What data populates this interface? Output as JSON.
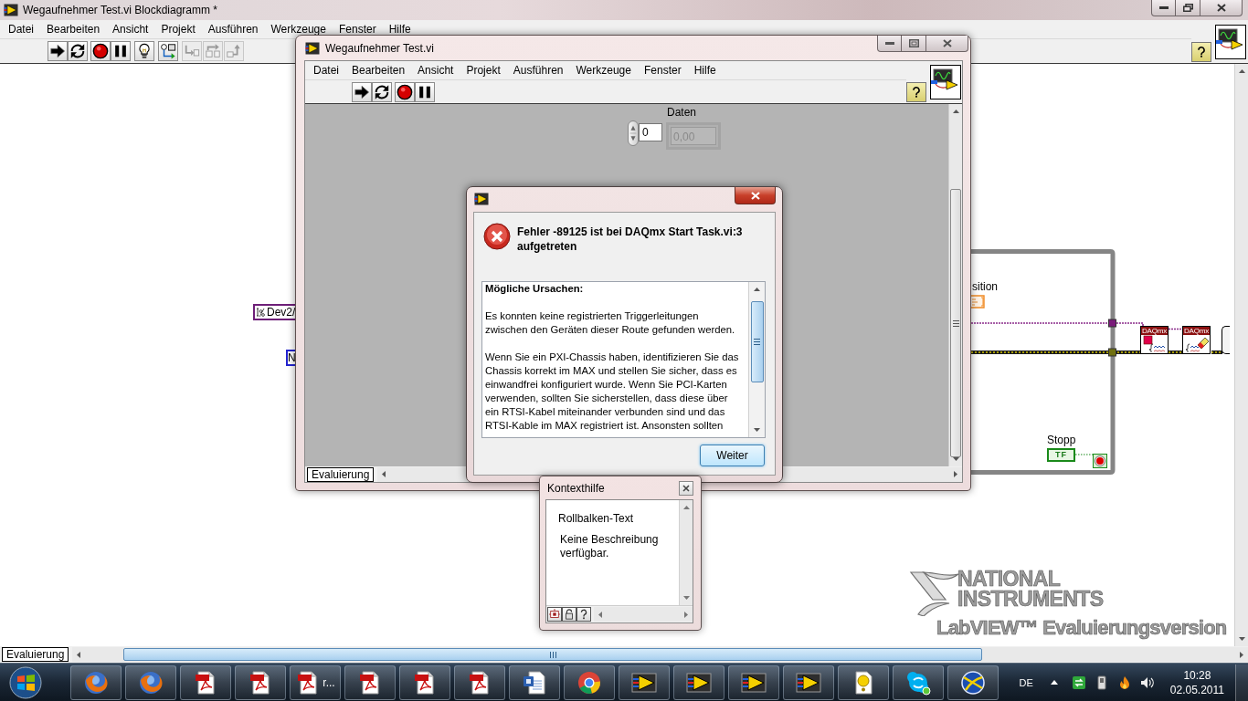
{
  "block_diagram_window": {
    "title": "Wegaufnehmer Test.vi Blockdiagramm *",
    "menu": [
      "Datei",
      "Bearbeiten",
      "Ansicht",
      "Projekt",
      "Ausführen",
      "Werkzeuge",
      "Fenster",
      "Hilfe"
    ],
    "toolbar": [
      {
        "kind": "run",
        "disabled": false
      },
      {
        "kind": "run_continuously",
        "disabled": false
      },
      {
        "kind": "abort",
        "disabled": false
      },
      {
        "kind": "pause",
        "disabled": false
      },
      {
        "kind": "highlight",
        "disabled": false
      },
      {
        "kind": "retain",
        "disabled": false
      },
      {
        "kind": "step_into",
        "disabled": true
      },
      {
        "kind": "step_over",
        "disabled": true
      },
      {
        "kind": "step_out",
        "disabled": true
      }
    ],
    "diagram": {
      "constants": [
        {
          "kind": "io_name",
          "text": "Dev2/"
        },
        {
          "kind": "numeric",
          "text": "N"
        }
      ],
      "terminal_label": "sition",
      "nodes": [
        {
          "kind": "start",
          "title": "DAQmx"
        },
        {
          "kind": "clear",
          "title": "DAQmx"
        }
      ],
      "stop_control": {
        "label": "Stopp",
        "text": "TF"
      }
    },
    "bottom_tab": "Evaluierung"
  },
  "front_panel_window": {
    "title": "Wegaufnehmer Test.vi",
    "menu": [
      "Datei",
      "Bearbeiten",
      "Ansicht",
      "Projekt",
      "Ausführen",
      "Werkzeuge",
      "Fenster",
      "Hilfe"
    ],
    "toolbar": [
      {
        "kind": "run",
        "disabled": false
      },
      {
        "kind": "run_continuously",
        "disabled": false
      },
      {
        "kind": "abort",
        "disabled": false
      },
      {
        "kind": "pause",
        "disabled": false
      }
    ],
    "array_control": {
      "label": "Daten",
      "index": "0",
      "value": "0,00",
      "disabled": true
    },
    "bottom_tab": "Evaluierung"
  },
  "error_dialog": {
    "heading": "Fehler -89125 ist bei DAQmx Start Task.vi:3 aufgetreten",
    "message": [
      {
        "kind": "heading",
        "text": "Mögliche Ursachen:"
      },
      {
        "kind": "paragraph",
        "text": "Es konnten keine registrierten Triggerleitungen\nzwischen den Geräten dieser Route gefunden werden."
      },
      {
        "kind": "paragraph",
        "text": "Wenn Sie ein PXI-Chassis haben, identifizieren Sie das\nChassis korrekt im MAX und stellen Sie sicher, dass es\neinwandfrei konfiguriert wurde. Wenn Sie PCI-Karten\nverwenden, sollten Sie sicherstellen, dass diese über\nein RTSI-Kabel miteinander verbunden sind und das\nRTSI-Kable im MAX registriert ist. Ansonsten sollten"
      }
    ],
    "button": "Weiter"
  },
  "context_help": {
    "title": "Kontexthilfe",
    "topic": "Rollbalken-Text",
    "description": "Keine Beschreibung verfügbar."
  },
  "evaluation_badge": {
    "lines": [
      "NATIONAL",
      "INSTRUMENTS",
      "LabVIEW™ Evaluierungsversion"
    ]
  },
  "taskbar": {
    "buttons": [
      {
        "kind": "firefox"
      },
      {
        "kind": "firefox"
      },
      {
        "kind": "pdf"
      },
      {
        "kind": "pdf"
      },
      {
        "kind": "pdf",
        "label": "r..."
      },
      {
        "kind": "pdf"
      },
      {
        "kind": "pdf"
      },
      {
        "kind": "pdf"
      },
      {
        "kind": "word"
      },
      {
        "kind": "chrome"
      },
      {
        "kind": "labview"
      },
      {
        "kind": "labview"
      },
      {
        "kind": "labview"
      },
      {
        "kind": "labview"
      },
      {
        "kind": "help"
      },
      {
        "kind": "skype"
      },
      {
        "kind": "ni"
      }
    ],
    "language": "DE",
    "time": "10:28",
    "date": "02.05.2011"
  }
}
